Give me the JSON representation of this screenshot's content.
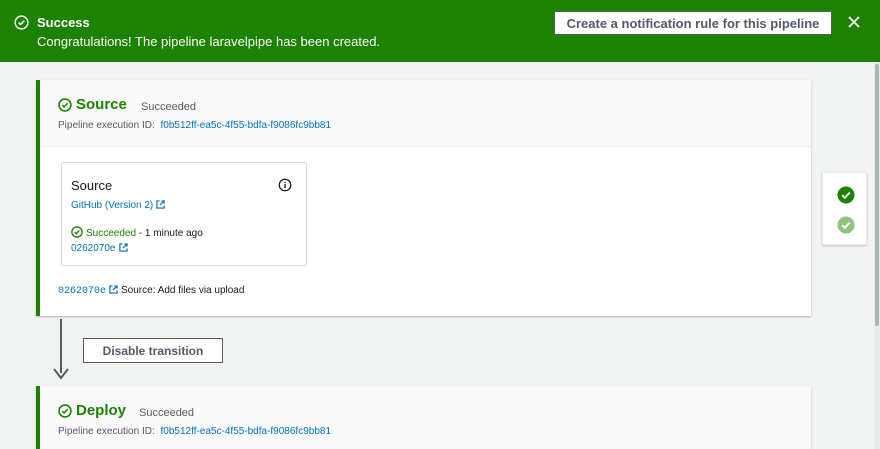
{
  "flash": {
    "title": "Success",
    "message": "Congratulations! The pipeline laravelpipe has been created.",
    "button_label": "Create a notification rule for this pipeline",
    "icon": "check-circle-icon",
    "close_icon": "close-icon",
    "color": "#1d8102"
  },
  "stages": [
    {
      "name": "Source",
      "status": "Succeeded",
      "execution_label": "Pipeline execution ID:",
      "execution_id": "f0b512ff-ea5c-4f55-bdfa-f9086fc9bb81",
      "action": {
        "name": "Source",
        "provider": "GitHub (Version 2)",
        "status": "Succeeded",
        "time": "- 1 minute ago",
        "commit": "0262070e"
      },
      "footer": {
        "commit": "0262070e",
        "message": "Source: Add files via upload"
      }
    },
    {
      "name": "Deploy",
      "status": "Succeeded",
      "execution_label": "Pipeline execution ID:",
      "execution_id": "f0b512ff-ea5c-4f55-bdfa-f9086fc9bb81"
    }
  ],
  "transition": {
    "button_label": "Disable transition"
  },
  "colors": {
    "success": "#1d8102",
    "success_light": "#8ec47e",
    "link": "#0073bb"
  }
}
